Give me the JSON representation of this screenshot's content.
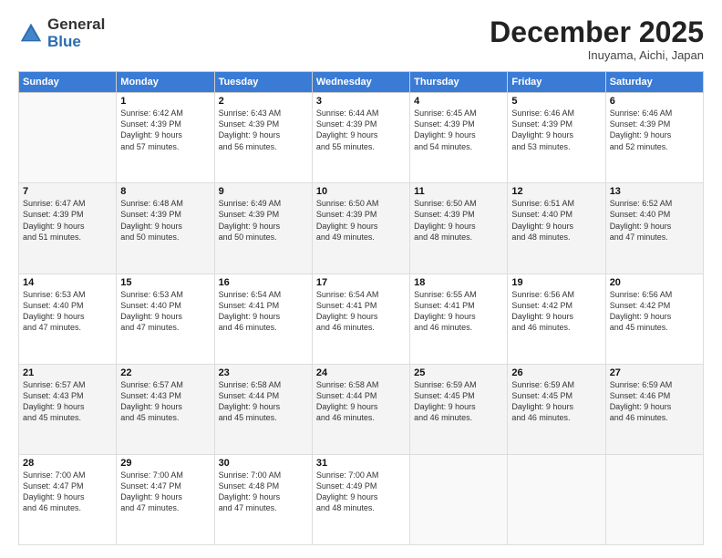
{
  "header": {
    "logo_general": "General",
    "logo_blue": "Blue",
    "month_title": "December 2025",
    "location": "Inuyama, Aichi, Japan"
  },
  "days_of_week": [
    "Sunday",
    "Monday",
    "Tuesday",
    "Wednesday",
    "Thursday",
    "Friday",
    "Saturday"
  ],
  "weeks": [
    [
      {
        "day": "",
        "info": ""
      },
      {
        "day": "1",
        "info": "Sunrise: 6:42 AM\nSunset: 4:39 PM\nDaylight: 9 hours\nand 57 minutes."
      },
      {
        "day": "2",
        "info": "Sunrise: 6:43 AM\nSunset: 4:39 PM\nDaylight: 9 hours\nand 56 minutes."
      },
      {
        "day": "3",
        "info": "Sunrise: 6:44 AM\nSunset: 4:39 PM\nDaylight: 9 hours\nand 55 minutes."
      },
      {
        "day": "4",
        "info": "Sunrise: 6:45 AM\nSunset: 4:39 PM\nDaylight: 9 hours\nand 54 minutes."
      },
      {
        "day": "5",
        "info": "Sunrise: 6:46 AM\nSunset: 4:39 PM\nDaylight: 9 hours\nand 53 minutes."
      },
      {
        "day": "6",
        "info": "Sunrise: 6:46 AM\nSunset: 4:39 PM\nDaylight: 9 hours\nand 52 minutes."
      }
    ],
    [
      {
        "day": "7",
        "info": "Sunrise: 6:47 AM\nSunset: 4:39 PM\nDaylight: 9 hours\nand 51 minutes."
      },
      {
        "day": "8",
        "info": "Sunrise: 6:48 AM\nSunset: 4:39 PM\nDaylight: 9 hours\nand 50 minutes."
      },
      {
        "day": "9",
        "info": "Sunrise: 6:49 AM\nSunset: 4:39 PM\nDaylight: 9 hours\nand 50 minutes."
      },
      {
        "day": "10",
        "info": "Sunrise: 6:50 AM\nSunset: 4:39 PM\nDaylight: 9 hours\nand 49 minutes."
      },
      {
        "day": "11",
        "info": "Sunrise: 6:50 AM\nSunset: 4:39 PM\nDaylight: 9 hours\nand 48 minutes."
      },
      {
        "day": "12",
        "info": "Sunrise: 6:51 AM\nSunset: 4:40 PM\nDaylight: 9 hours\nand 48 minutes."
      },
      {
        "day": "13",
        "info": "Sunrise: 6:52 AM\nSunset: 4:40 PM\nDaylight: 9 hours\nand 47 minutes."
      }
    ],
    [
      {
        "day": "14",
        "info": "Sunrise: 6:53 AM\nSunset: 4:40 PM\nDaylight: 9 hours\nand 47 minutes."
      },
      {
        "day": "15",
        "info": "Sunrise: 6:53 AM\nSunset: 4:40 PM\nDaylight: 9 hours\nand 47 minutes."
      },
      {
        "day": "16",
        "info": "Sunrise: 6:54 AM\nSunset: 4:41 PM\nDaylight: 9 hours\nand 46 minutes."
      },
      {
        "day": "17",
        "info": "Sunrise: 6:54 AM\nSunset: 4:41 PM\nDaylight: 9 hours\nand 46 minutes."
      },
      {
        "day": "18",
        "info": "Sunrise: 6:55 AM\nSunset: 4:41 PM\nDaylight: 9 hours\nand 46 minutes."
      },
      {
        "day": "19",
        "info": "Sunrise: 6:56 AM\nSunset: 4:42 PM\nDaylight: 9 hours\nand 46 minutes."
      },
      {
        "day": "20",
        "info": "Sunrise: 6:56 AM\nSunset: 4:42 PM\nDaylight: 9 hours\nand 45 minutes."
      }
    ],
    [
      {
        "day": "21",
        "info": "Sunrise: 6:57 AM\nSunset: 4:43 PM\nDaylight: 9 hours\nand 45 minutes."
      },
      {
        "day": "22",
        "info": "Sunrise: 6:57 AM\nSunset: 4:43 PM\nDaylight: 9 hours\nand 45 minutes."
      },
      {
        "day": "23",
        "info": "Sunrise: 6:58 AM\nSunset: 4:44 PM\nDaylight: 9 hours\nand 45 minutes."
      },
      {
        "day": "24",
        "info": "Sunrise: 6:58 AM\nSunset: 4:44 PM\nDaylight: 9 hours\nand 46 minutes."
      },
      {
        "day": "25",
        "info": "Sunrise: 6:59 AM\nSunset: 4:45 PM\nDaylight: 9 hours\nand 46 minutes."
      },
      {
        "day": "26",
        "info": "Sunrise: 6:59 AM\nSunset: 4:45 PM\nDaylight: 9 hours\nand 46 minutes."
      },
      {
        "day": "27",
        "info": "Sunrise: 6:59 AM\nSunset: 4:46 PM\nDaylight: 9 hours\nand 46 minutes."
      }
    ],
    [
      {
        "day": "28",
        "info": "Sunrise: 7:00 AM\nSunset: 4:47 PM\nDaylight: 9 hours\nand 46 minutes."
      },
      {
        "day": "29",
        "info": "Sunrise: 7:00 AM\nSunset: 4:47 PM\nDaylight: 9 hours\nand 47 minutes."
      },
      {
        "day": "30",
        "info": "Sunrise: 7:00 AM\nSunset: 4:48 PM\nDaylight: 9 hours\nand 47 minutes."
      },
      {
        "day": "31",
        "info": "Sunrise: 7:00 AM\nSunset: 4:49 PM\nDaylight: 9 hours\nand 48 minutes."
      },
      {
        "day": "",
        "info": ""
      },
      {
        "day": "",
        "info": ""
      },
      {
        "day": "",
        "info": ""
      }
    ]
  ]
}
